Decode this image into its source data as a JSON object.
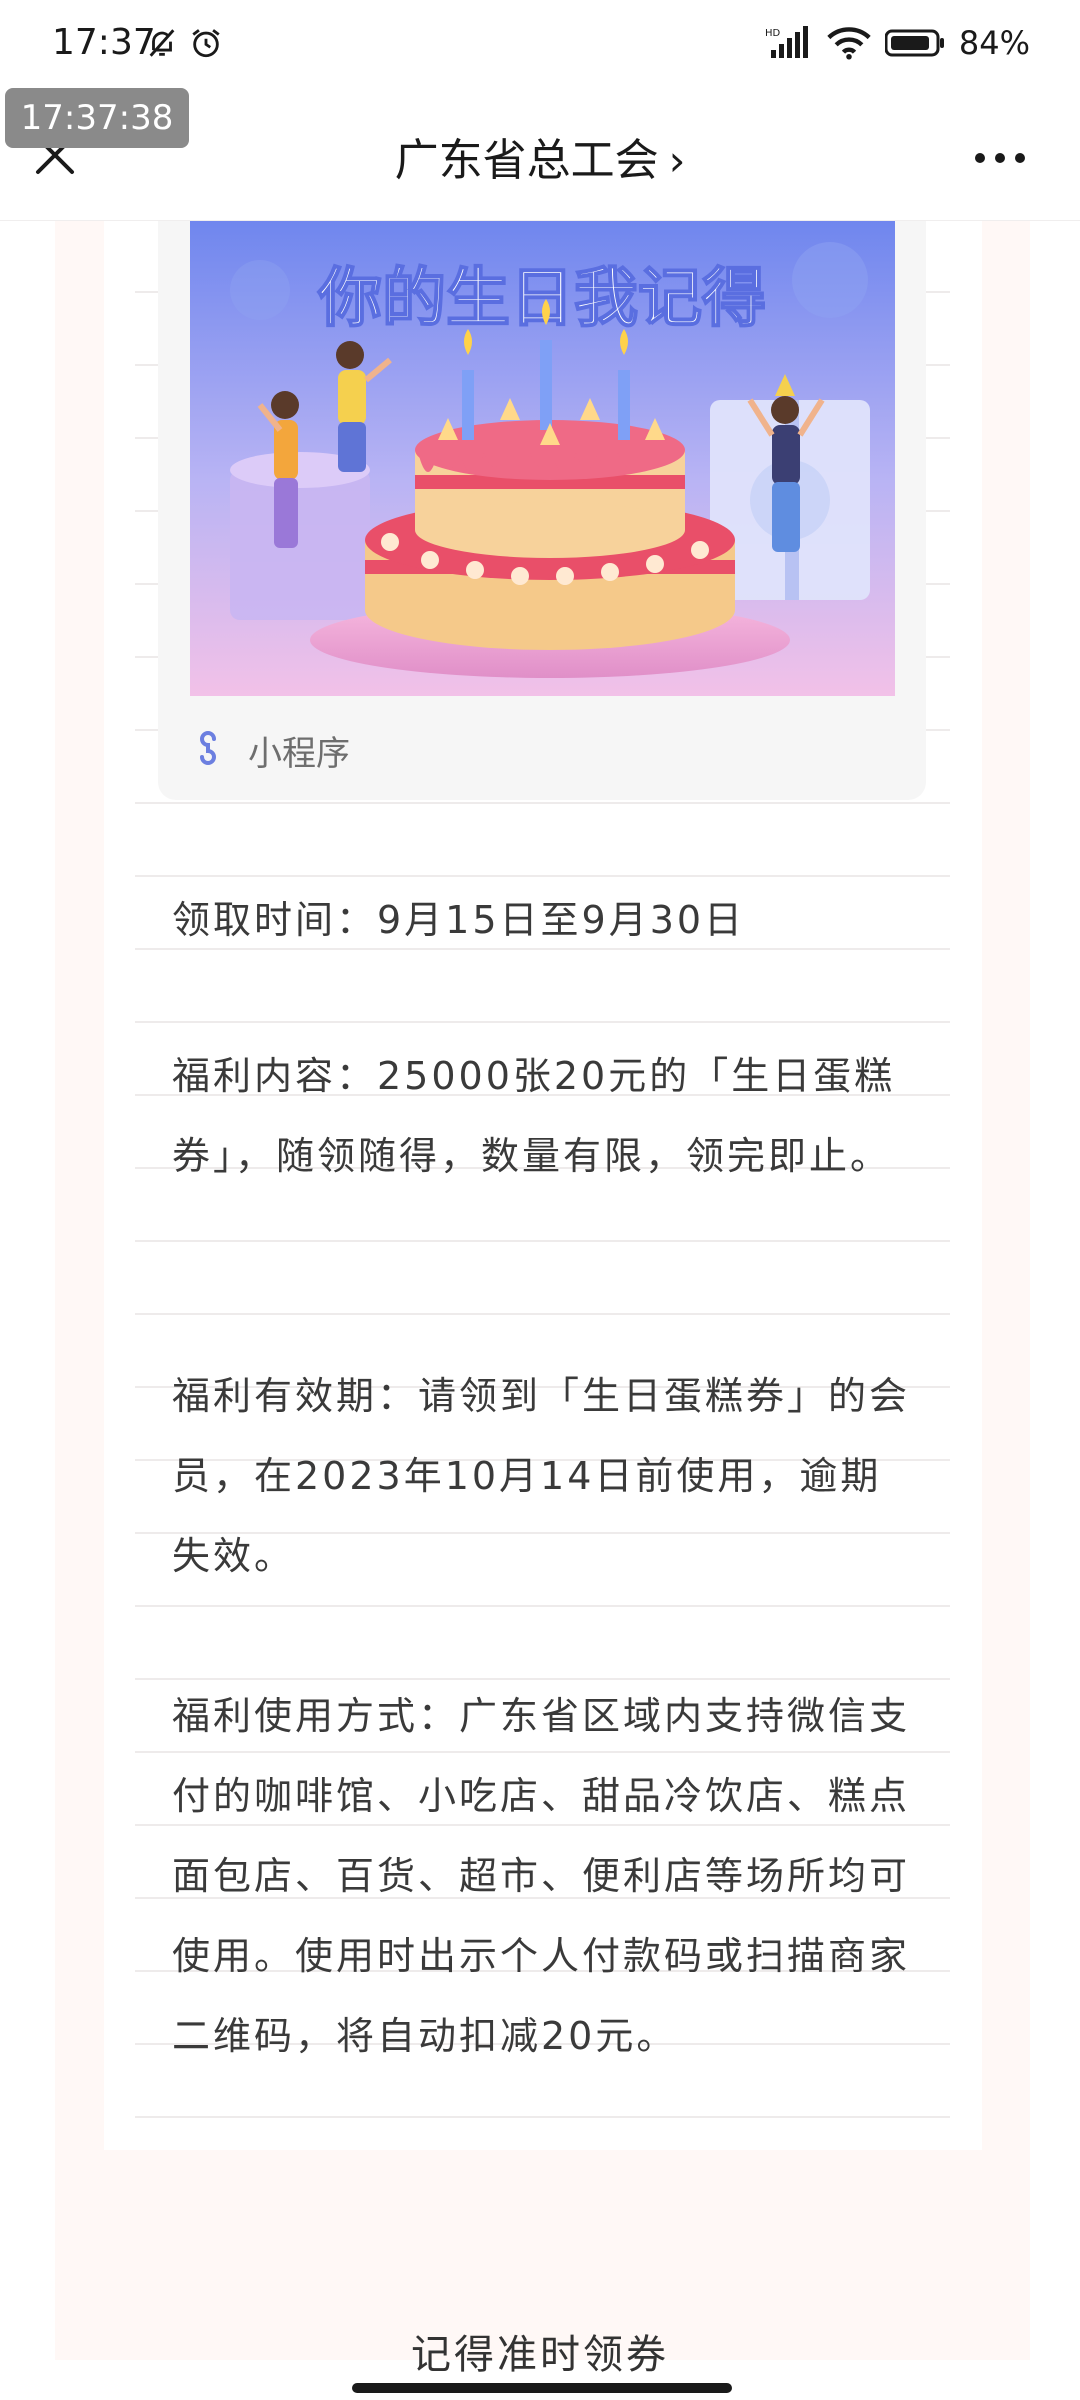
{
  "status_bar": {
    "time": "17:37",
    "battery": "84%",
    "icons": [
      "bell-off-icon",
      "alarm-icon",
      "hd-signal-icon",
      "wifi-icon",
      "battery-icon"
    ]
  },
  "overlay": {
    "timestamp": "17:37:38"
  },
  "nav": {
    "title": "广东省总工会",
    "chevron": "›",
    "close_icon": "close-icon",
    "more_icon": "more-icon"
  },
  "mini_program": {
    "banner_title": "你的生日我记得",
    "label": "小程序"
  },
  "article": {
    "claim_time": "领取时间：9月15日至9月30日",
    "benefit_content": "福利内容：25000张20元的「生日蛋糕券」，随领随得，数量有限，领完即止。",
    "validity": "福利有效期：请领到「生日蛋糕券」的会员，在2023年10月14日前使用，逾期失效。",
    "usage": "福利使用方式：广东省区域内支持微信支付的咖啡馆、小吃店、甜品冷饮店、糕点面包店、百货、超市、便利店等场所均可使用。使用时出示个人付款码或扫描商家二维码，将自动扣减20元。"
  },
  "footer": {
    "text": "记得准时领券"
  },
  "colors": {
    "page_bg": "#fff8f6",
    "banner_top": "#6f86ee",
    "banner_bottom": "#f2c1e8",
    "cake": "#e94f69",
    "text": "#3a3a3a"
  }
}
